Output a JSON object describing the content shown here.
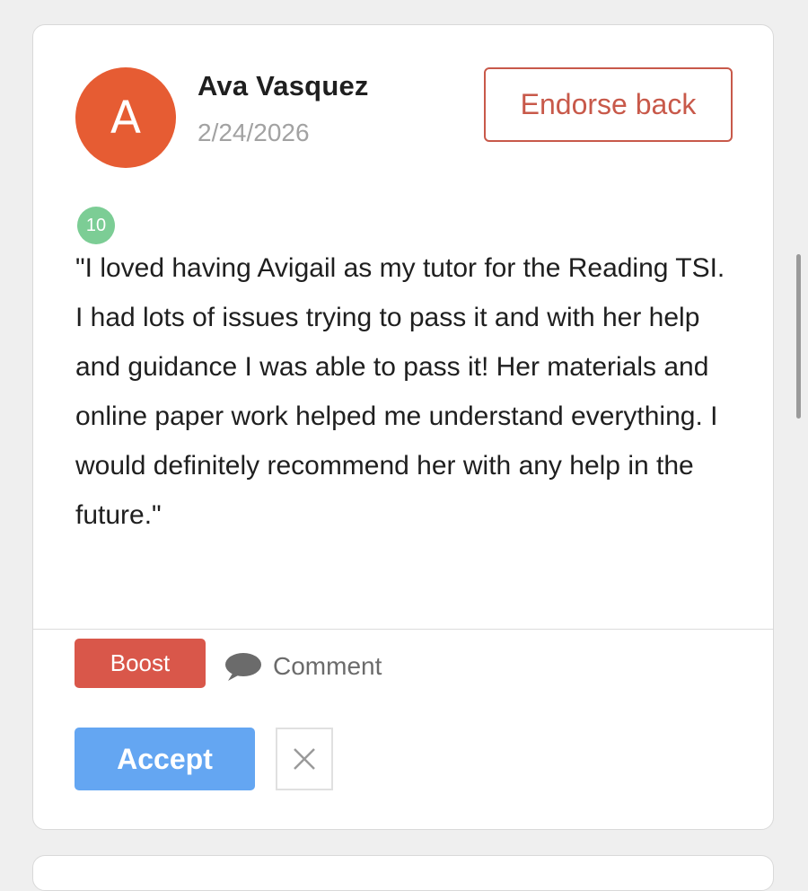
{
  "review_card": {
    "author": {
      "avatar_letter": "A",
      "name": "Ava Vasquez",
      "date": "2/24/2026"
    },
    "endorse_label": "Endorse back",
    "score_badge": "10",
    "review_text": "\"I loved having Avigail as my tutor for the Reading TSI. I had lots of issues trying to pass it and with her help and guidance I was able to pass it! Her materials and online paper work helped me understand everything. I would definitely recommend her with any help in the future.\"",
    "actions": {
      "boost_label": "Boost",
      "comment_label": "Comment",
      "accept_label": "Accept",
      "dismiss_icon": "close-icon"
    }
  },
  "colors": {
    "avatar_bg": "#e65c33",
    "accent_red": "#c8594a",
    "boost_bg": "#d9574a",
    "score_bg": "#7ccd95",
    "accept_bg": "#64a6f2",
    "muted_text": "#a2a2a2"
  }
}
